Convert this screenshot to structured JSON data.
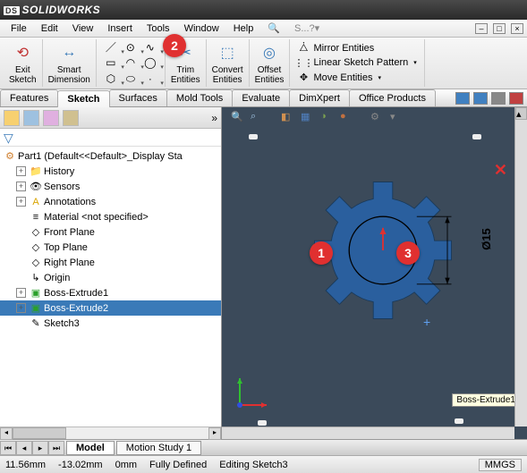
{
  "app": {
    "name": "SOLIDWORKS"
  },
  "menu": [
    "File",
    "Edit",
    "View",
    "Insert",
    "Tools",
    "Window",
    "Help"
  ],
  "ribbon": {
    "exit_sketch": "Exit\nSketch",
    "smart_dimension": "Smart\nDimension",
    "trim": "Trim\nEntities",
    "convert": "Convert\nEntities",
    "offset": "Offset\nEntities",
    "mirror": "Mirror Entities",
    "pattern": "Linear Sketch Pattern",
    "move": "Move Entities"
  },
  "tabs": [
    "Features",
    "Sketch",
    "Surfaces",
    "Mold Tools",
    "Evaluate",
    "DimXpert",
    "Office Products"
  ],
  "active_tab": "Sketch",
  "tree": {
    "root": "Part1  (Default<<Default>_Display Sta",
    "items": [
      {
        "label": "History",
        "icon": "📁",
        "exp": "+"
      },
      {
        "label": "Sensors",
        "icon": "👁",
        "exp": "+"
      },
      {
        "label": "Annotations",
        "icon": "A",
        "exp": "+",
        "iconColor": "#d9a400",
        "iconBg": "#fff"
      },
      {
        "label": "Material <not specified>",
        "icon": "≡",
        "exp": ""
      },
      {
        "label": "Front Plane",
        "icon": "◇",
        "exp": ""
      },
      {
        "label": "Top Plane",
        "icon": "◇",
        "exp": ""
      },
      {
        "label": "Right Plane",
        "icon": "◇",
        "exp": ""
      },
      {
        "label": "Origin",
        "icon": "↳",
        "exp": ""
      },
      {
        "label": "Boss-Extrude1",
        "icon": "▣",
        "exp": "+",
        "iconColor": "#2aa02a"
      },
      {
        "label": "Boss-Extrude2",
        "icon": "▣",
        "exp": "+",
        "iconColor": "#2aa02a",
        "selected": true
      },
      {
        "label": "Sketch3",
        "icon": "✎",
        "exp": ""
      }
    ]
  },
  "viewport": {
    "dimension": "Ø15",
    "tooltip": "Boss-Extrude1"
  },
  "markers": {
    "m1": "1",
    "m2": "2",
    "m3": "3"
  },
  "bottom_tabs": [
    "Model",
    "Motion Study 1"
  ],
  "active_bottom_tab": "Model",
  "status": {
    "x": "11.56mm",
    "y": "-13.02mm",
    "z": "0mm",
    "defined": "Fully Defined",
    "mode": "Editing Sketch3",
    "units": "MMGS"
  }
}
